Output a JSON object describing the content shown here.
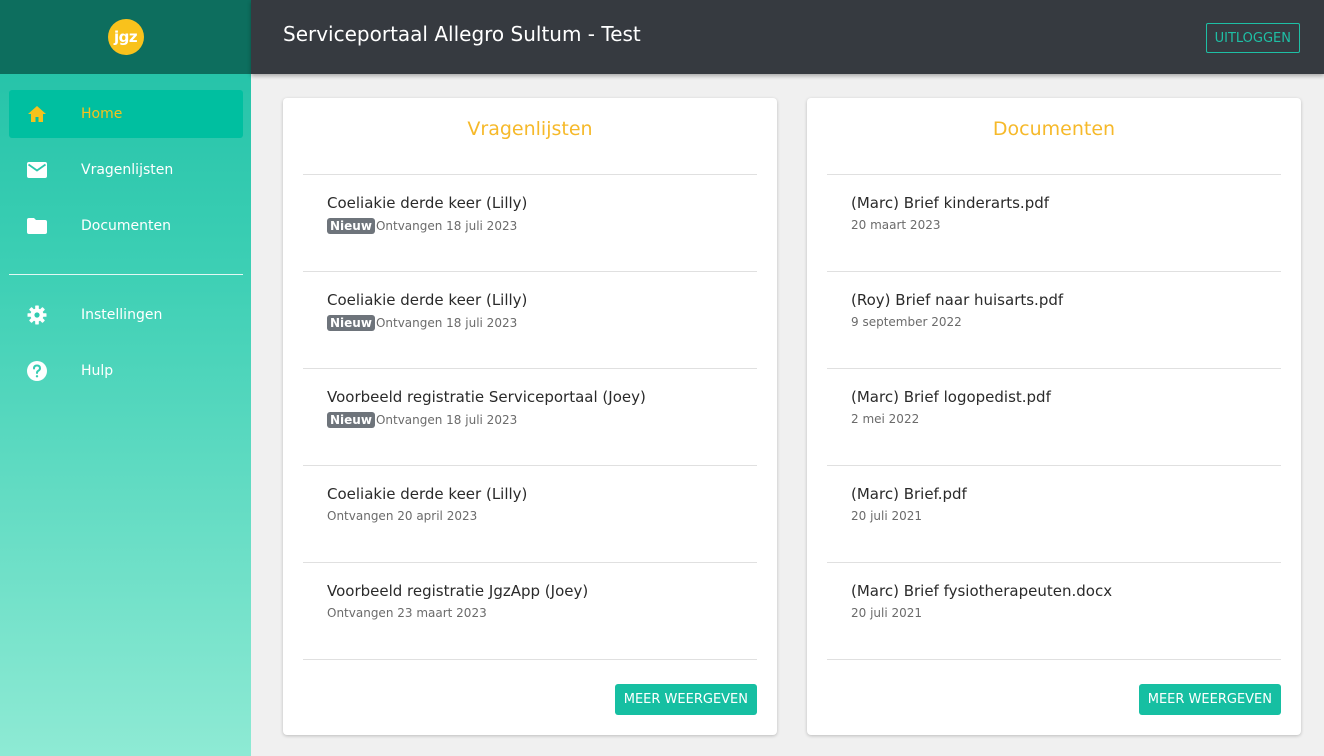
{
  "app": {
    "logo_text": "jgz",
    "title": "Serviceportaal Allegro Sultum - Test",
    "logout_label": "UITLOGGEN"
  },
  "colors": {
    "accent": "#16bfa2",
    "header_bg": "#363a40",
    "title_orange": "#f6b92a",
    "logo_yellow": "#f9c21c"
  },
  "sidebar": {
    "items": [
      {
        "label": "Home",
        "icon": "home-icon",
        "active": true
      },
      {
        "label": "Vragenlijsten",
        "icon": "mail-icon",
        "active": false
      },
      {
        "label": "Documenten",
        "icon": "folder-icon",
        "active": false
      },
      {
        "label": "Instellingen",
        "icon": "gear-icon",
        "active": false
      },
      {
        "label": "Hulp",
        "icon": "help-icon",
        "active": false
      }
    ]
  },
  "questionnaires": {
    "title": "Vragenlijsten",
    "more_label": "MEER WEERGEVEN",
    "items": [
      {
        "title": "Coeliakie derde keer (Lilly)",
        "badge": "Nieuw",
        "date": "Ontvangen 18 juli 2023"
      },
      {
        "title": "Coeliakie derde keer (Lilly)",
        "badge": "Nieuw",
        "date": "Ontvangen 18 juli 2023"
      },
      {
        "title": "Voorbeeld registratie Serviceportaal (Joey)",
        "badge": "Nieuw",
        "date": "Ontvangen 18 juli 2023"
      },
      {
        "title": "Coeliakie derde keer (Lilly)",
        "badge": "",
        "date": "Ontvangen 20 april 2023"
      },
      {
        "title": "Voorbeeld registratie JgzApp (Joey)",
        "badge": "",
        "date": "Ontvangen 23 maart 2023"
      }
    ]
  },
  "documents": {
    "title": "Documenten",
    "more_label": "MEER WEERGEVEN",
    "items": [
      {
        "title": "(Marc) Brief kinderarts.pdf",
        "date": "20 maart 2023"
      },
      {
        "title": "(Roy) Brief naar huisarts.pdf",
        "date": "9 september 2022"
      },
      {
        "title": "(Marc) Brief logopedist.pdf",
        "date": "2 mei 2022"
      },
      {
        "title": "(Marc) Brief.pdf",
        "date": "20 juli 2021"
      },
      {
        "title": "(Marc) Brief fysiotherapeuten.docx",
        "date": "20 juli 2021"
      }
    ]
  }
}
